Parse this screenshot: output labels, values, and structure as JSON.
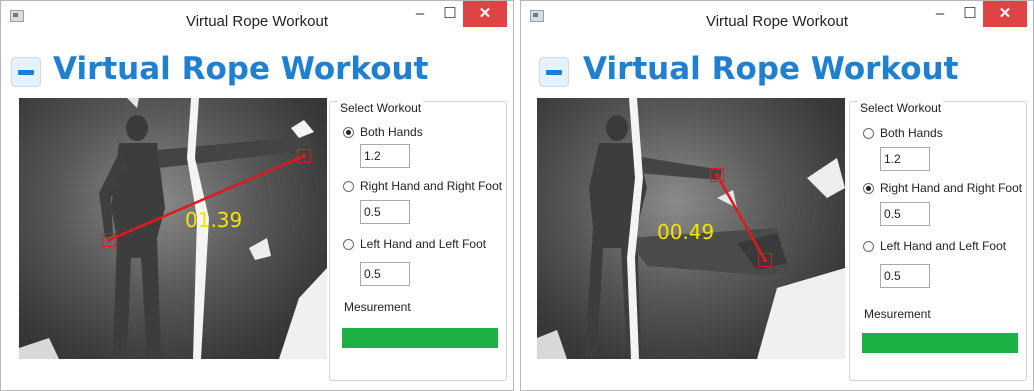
{
  "windows": [
    {
      "title": "Virtual Rope Workout",
      "header_title": "Virtual Rope Workout",
      "distance": "01.39",
      "workout": {
        "legend": "Select Workout",
        "options": [
          {
            "label": "Both Hands",
            "value": "1.2",
            "selected": true
          },
          {
            "label": "Right Hand and Right Foot",
            "value": "0.5",
            "selected": false
          },
          {
            "label": "Left Hand and Left Foot",
            "value": "0.5",
            "selected": false
          }
        ]
      },
      "measurement": {
        "label": "Mesurement",
        "level": 1.0
      },
      "controls": {
        "minimize": "–",
        "maximize": "☐",
        "close": "✕"
      }
    },
    {
      "title": "Virtual Rope Workout",
      "header_title": "Virtual Rope Workout",
      "distance": "00.49",
      "workout": {
        "legend": "Select Workout",
        "options": [
          {
            "label": "Both Hands",
            "value": "1.2",
            "selected": false
          },
          {
            "label": "Right Hand and Right Foot",
            "value": "0.5",
            "selected": true
          },
          {
            "label": "Left Hand and Left Foot",
            "value": "0.5",
            "selected": false
          }
        ]
      },
      "measurement": {
        "label": "Mesurement",
        "level": 1.0
      },
      "controls": {
        "minimize": "–",
        "maximize": "☐",
        "close": "✕"
      }
    }
  ],
  "colors": {
    "accent": "#1f7fd0",
    "progress": "#1cb144",
    "joint": "#e01a1a",
    "distance_text": "#f2e600"
  }
}
